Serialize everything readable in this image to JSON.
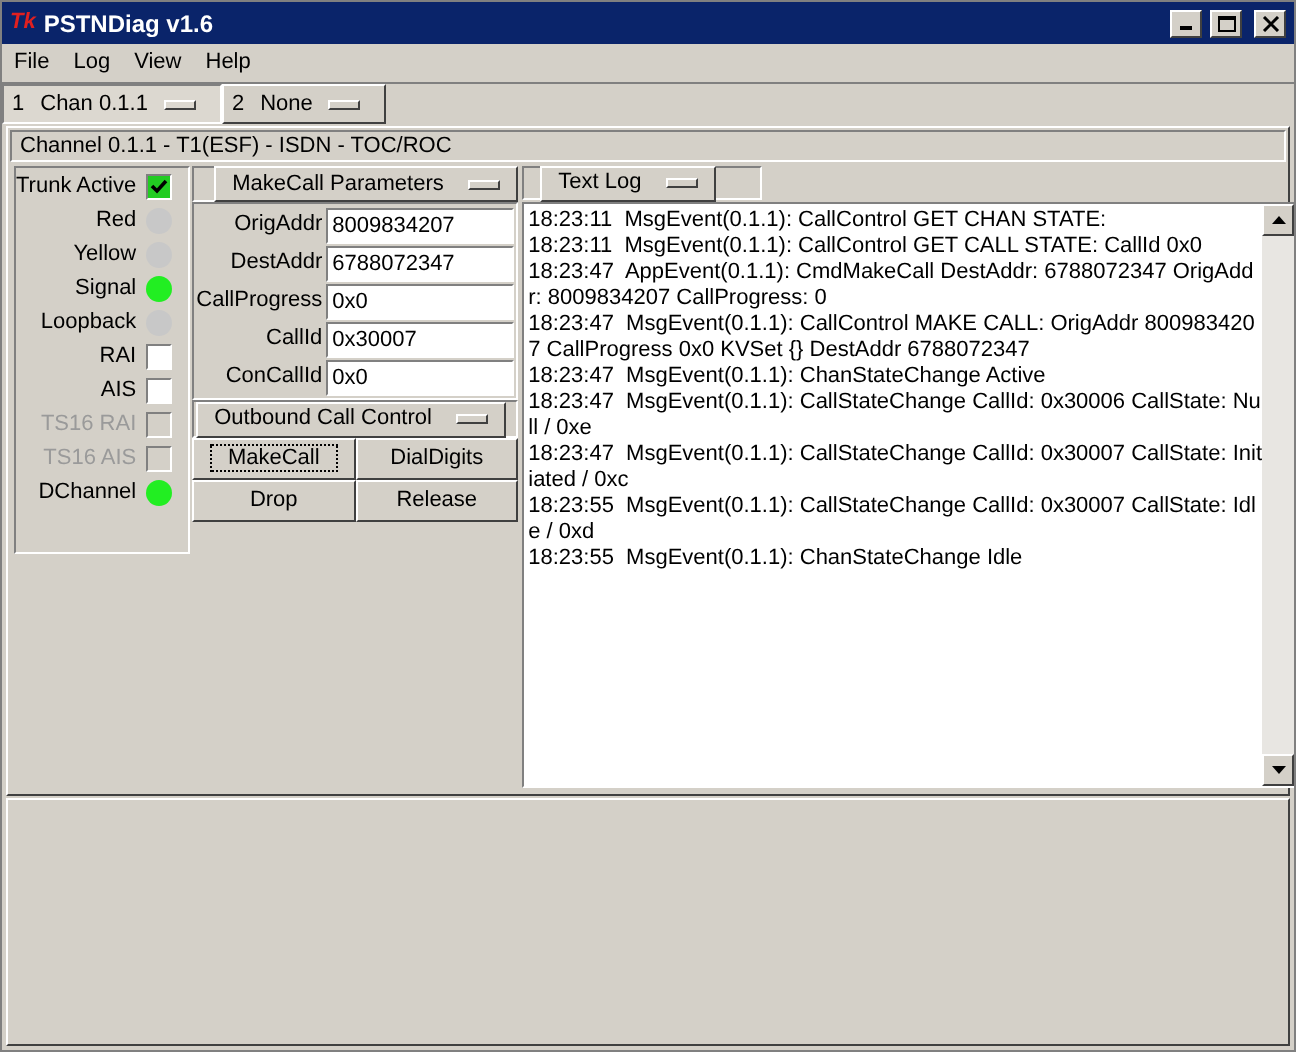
{
  "window": {
    "title": "PSTNDiag v1.6",
    "logo": "Tk"
  },
  "menu": [
    "File",
    "Log",
    "View",
    "Help"
  ],
  "channel_tabs": [
    {
      "index": "1",
      "label": "Chan 0.1.1",
      "selected": true
    },
    {
      "index": "2",
      "label": "None",
      "selected": false
    }
  ],
  "channel_header": "Channel 0.1.1 - T1(ESF) - ISDN - TOC/ROC",
  "indicators": [
    {
      "kind": "checkbox",
      "label": "Trunk Active",
      "checked": true,
      "disabled": false
    },
    {
      "kind": "led",
      "label": "Red",
      "on": false
    },
    {
      "kind": "led",
      "label": "Yellow",
      "on": false
    },
    {
      "kind": "led",
      "label": "Signal",
      "on": true
    },
    {
      "kind": "led",
      "label": "Loopback",
      "on": false
    },
    {
      "kind": "checkbox",
      "label": "RAI",
      "checked": false,
      "disabled": false
    },
    {
      "kind": "checkbox",
      "label": "AIS",
      "checked": false,
      "disabled": false
    },
    {
      "kind": "checkbox",
      "label": "TS16 RAI",
      "checked": false,
      "disabled": true
    },
    {
      "kind": "checkbox",
      "label": "TS16 AIS",
      "checked": false,
      "disabled": true
    },
    {
      "kind": "led",
      "label": "DChannel",
      "on": true
    }
  ],
  "makecall": {
    "title": "MakeCall Parameters",
    "fields": [
      {
        "label": "OrigAddr",
        "value": "8009834207"
      },
      {
        "label": "DestAddr",
        "value": "6788072347"
      },
      {
        "label": "CallProgress",
        "value": "0x0"
      },
      {
        "label": "CallId",
        "value": "0x30007"
      },
      {
        "label": "ConCallId",
        "value": "0x0"
      }
    ]
  },
  "call_control": {
    "title": "Outbound Call Control",
    "buttons": [
      {
        "label": "MakeCall",
        "focused": true
      },
      {
        "label": "DialDigits",
        "focused": false
      },
      {
        "label": "Drop",
        "focused": false
      },
      {
        "label": "Release",
        "focused": false
      }
    ]
  },
  "log": {
    "title": "Text Log",
    "lines": [
      "18:23:11  MsgEvent(0.1.1): CallControl GET CHAN STATE:",
      "18:23:11  MsgEvent(0.1.1): CallControl GET CALL STATE: CallId 0x0",
      "18:23:47  AppEvent(0.1.1): CmdMakeCall DestAddr: 6788072347 OrigAdd",
      "r: 8009834207 CallProgress: 0",
      "18:23:47  MsgEvent(0.1.1): CallControl MAKE CALL: OrigAddr 800983420",
      "7 CallProgress 0x0 KVSet {} DestAddr 6788072347",
      "18:23:47  MsgEvent(0.1.1): ChanStateChange Active",
      "18:23:47  MsgEvent(0.1.1): CallStateChange CallId: 0x30006 CallState: Nu",
      "ll / 0xe",
      "18:23:47  MsgEvent(0.1.1): CallStateChange CallId: 0x30007 CallState: Init",
      "iated / 0xc",
      "18:23:55  MsgEvent(0.1.1): CallStateChange CallId: 0x30007 CallState: Idl",
      "e / 0xd",
      "18:23:55  MsgEvent(0.1.1): ChanStateChange Idle"
    ]
  }
}
